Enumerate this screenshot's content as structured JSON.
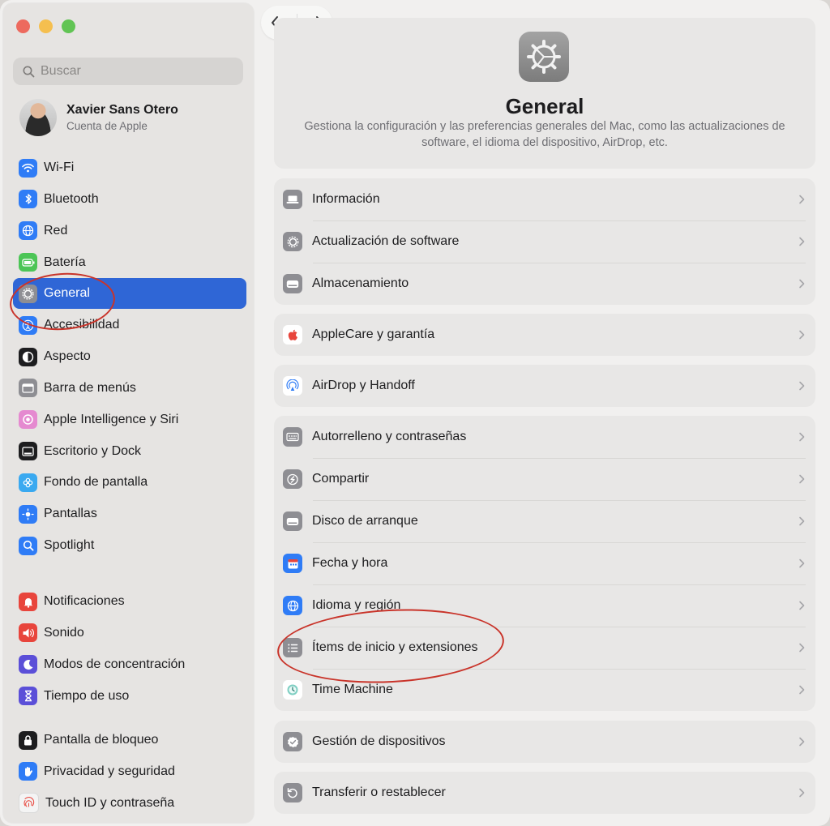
{
  "sidebar": {
    "search_placeholder": "Buscar",
    "account": {
      "name": "Xavier Sans Otero",
      "subtitle": "Cuenta de Apple"
    },
    "groups": [
      [
        {
          "label": "Wi-Fi",
          "icon": "wifi-icon",
          "color": "#2f7cf6"
        },
        {
          "label": "Bluetooth",
          "icon": "bluetooth-icon",
          "color": "#2f7cf6"
        },
        {
          "label": "Red",
          "icon": "globe-icon",
          "color": "#2f7cf6"
        },
        {
          "label": "Batería",
          "icon": "battery-icon",
          "color": "#4cc556"
        },
        {
          "label": "General",
          "icon": "gear-icon",
          "color": "#8e8e93",
          "active": true
        },
        {
          "label": "Accesibilidad",
          "icon": "accessibility-icon",
          "color": "#2f7cf6"
        },
        {
          "label": "Aspecto",
          "icon": "appearance-icon",
          "color": "#1d1d1f"
        },
        {
          "label": "Barra de menús",
          "icon": "menubar-icon",
          "color": "#8e8e93"
        },
        {
          "label": "Apple Intelligence y Siri",
          "icon": "siri-icon",
          "color": "#e58ad0"
        },
        {
          "label": "Escritorio y Dock",
          "icon": "dock-icon",
          "color": "#1d1d1f"
        },
        {
          "label": "Fondo de pantalla",
          "icon": "wallpaper-icon",
          "color": "#3aa9f0"
        },
        {
          "label": "Pantallas",
          "icon": "display-icon",
          "color": "#2f7cf6"
        },
        {
          "label": "Spotlight",
          "icon": "spotlight-icon",
          "color": "#2f7cf6"
        }
      ],
      [
        {
          "label": "Notificaciones",
          "icon": "bell-icon",
          "color": "#e8453c"
        },
        {
          "label": "Sonido",
          "icon": "speaker-icon",
          "color": "#e8453c"
        },
        {
          "label": "Modos de concentración",
          "icon": "moon-icon",
          "color": "#5b4fd8"
        },
        {
          "label": "Tiempo de uso",
          "icon": "hourglass-icon",
          "color": "#5b4fd8"
        }
      ],
      [
        {
          "label": "Pantalla de bloqueo",
          "icon": "lock-icon",
          "color": "#1d1d1f"
        },
        {
          "label": "Privacidad y seguridad",
          "icon": "hand-icon",
          "color": "#2f7cf6"
        },
        {
          "label": "Touch ID y contraseña",
          "icon": "fingerprint-icon",
          "color": "#f4f4f4"
        }
      ]
    ]
  },
  "main": {
    "title": "General",
    "description": "Gestiona la configuración y las preferencias generales del Mac, como las actualizaciones de software, el idioma del dispositivo, AirDrop, etc.",
    "groups": [
      [
        {
          "label": "Información",
          "icon": "laptop-icon"
        },
        {
          "label": "Actualización de software",
          "icon": "gear-badge-icon"
        },
        {
          "label": "Almacenamiento",
          "icon": "drive-icon"
        }
      ],
      [
        {
          "label": "AppleCare y garantía",
          "icon": "apple-icon"
        }
      ],
      [
        {
          "label": "AirDrop y Handoff",
          "icon": "airdrop-icon"
        }
      ],
      [
        {
          "label": "Autorrelleno y contraseñas",
          "icon": "keyboard-icon"
        },
        {
          "label": "Compartir",
          "icon": "share-icon"
        },
        {
          "label": "Disco de arranque",
          "icon": "startup-disk-icon"
        },
        {
          "label": "Fecha y hora",
          "icon": "calendar-icon"
        },
        {
          "label": "Idioma y región",
          "icon": "globe-icon"
        },
        {
          "label": "Ítems de inicio y extensiones",
          "icon": "list-icon"
        },
        {
          "label": "Time Machine",
          "icon": "time-machine-icon"
        }
      ],
      [
        {
          "label": "Gestión de dispositivos",
          "icon": "check-badge-icon"
        }
      ],
      [
        {
          "label": "Transferir o restablecer",
          "icon": "reset-icon"
        }
      ]
    ]
  }
}
